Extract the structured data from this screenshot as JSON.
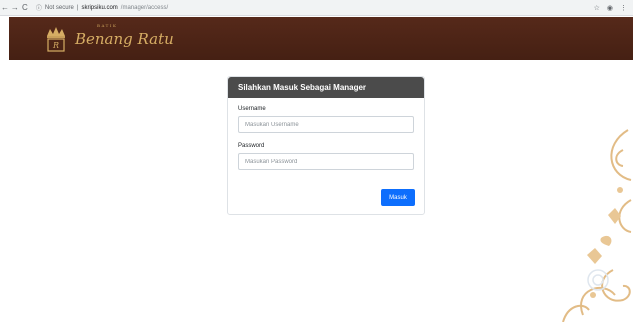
{
  "browser": {
    "back": "←",
    "forward": "→",
    "reload": "C",
    "security": "Not secure",
    "url_host": "skripsiku.com",
    "url_path": "/manager/access/"
  },
  "brand": {
    "tagline": "BATIK",
    "name": "Benang Ratu",
    "color": "#4a2414",
    "gold": "#d6ad64"
  },
  "login": {
    "title": "Silahkan Masuk Sebagai Manager",
    "username_label": "Username",
    "username_placeholder": "Masukan Username",
    "username_value": "",
    "password_label": "Password",
    "password_placeholder": "Masukan Password",
    "password_value": "",
    "submit_label": "Masuk",
    "accent": "#0d6efd"
  }
}
